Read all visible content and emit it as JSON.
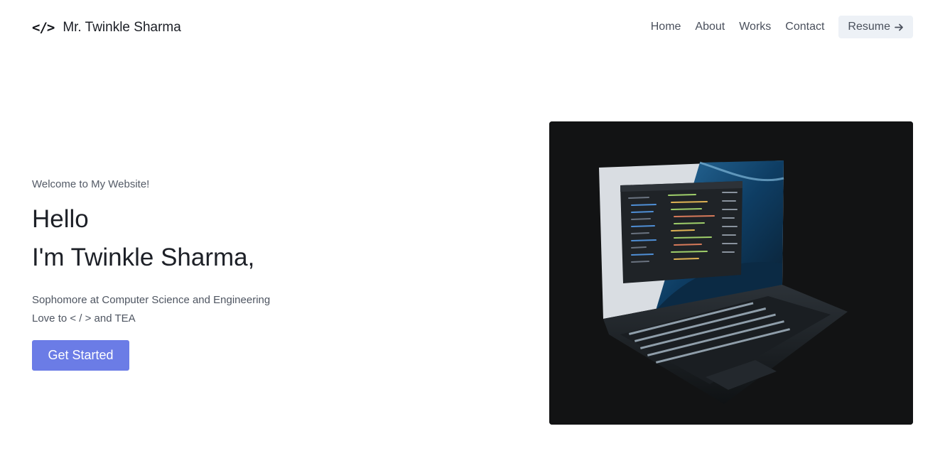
{
  "header": {
    "brand_icon": "</>",
    "brand_name": "Mr. Twinkle Sharma",
    "nav": [
      "Home",
      "About",
      "Works",
      "Contact"
    ],
    "resume_label": "Resume",
    "resume_icon": "arrow-right-icon"
  },
  "hero": {
    "welcome": "Welcome to My Website!",
    "hello": "Hello",
    "intro": "I'm Twinkle Sharma,",
    "desc_line1": "Sophomore at Computer Science and Engineering",
    "desc_line2": "Love to < / > and TEA",
    "cta_label": "Get Started"
  },
  "colors": {
    "accent": "#6b7ce6",
    "resume_bg": "#edf1f6",
    "image_bg": "#121314"
  }
}
